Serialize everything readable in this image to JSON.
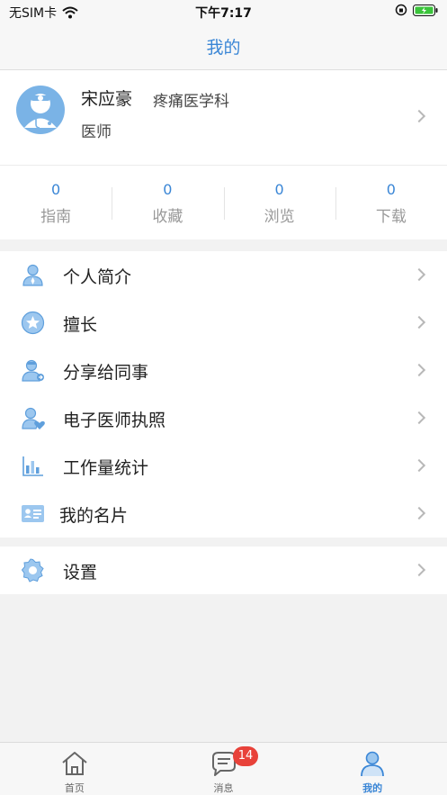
{
  "status_bar": {
    "carrier": "无SIM卡",
    "time": "下午7:17"
  },
  "nav": {
    "title": "我的"
  },
  "profile": {
    "name": "宋应豪",
    "department": "疼痛医学科",
    "title": "医师"
  },
  "stats": [
    {
      "value": "0",
      "label": "指南"
    },
    {
      "value": "0",
      "label": "收藏"
    },
    {
      "value": "0",
      "label": "浏览"
    },
    {
      "value": "0",
      "label": "下载"
    }
  ],
  "menu": {
    "items": [
      {
        "label": "个人简介",
        "icon": "person-icon"
      },
      {
        "label": "擅长",
        "icon": "star-icon"
      },
      {
        "label": "分享给同事",
        "icon": "share-doctor-icon"
      },
      {
        "label": "电子医师执照",
        "icon": "license-icon"
      },
      {
        "label": "工作量统计",
        "icon": "bar-chart-icon"
      },
      {
        "label": "我的名片",
        "icon": "business-card-icon"
      }
    ],
    "settings": {
      "label": "设置",
      "icon": "gear-icon"
    }
  },
  "tab_bar": {
    "tabs": [
      {
        "label": "首页",
        "icon": "home-icon"
      },
      {
        "label": "消息",
        "icon": "message-icon",
        "badge": "14"
      },
      {
        "label": "我的",
        "icon": "user-icon",
        "active": true
      }
    ]
  },
  "colors": {
    "accent": "#3a86d6",
    "icon_blue": "#7ab3e6",
    "badge_red": "#e8423a"
  }
}
